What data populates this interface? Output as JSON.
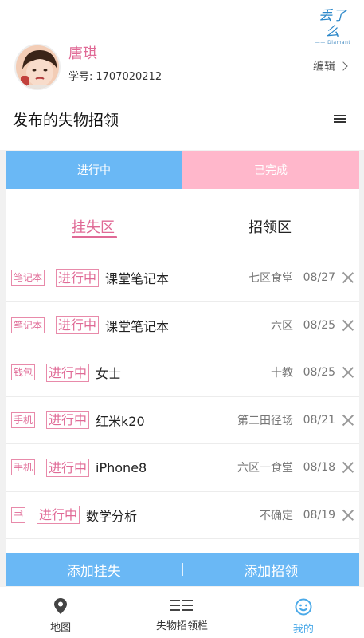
{
  "logo": {
    "main": "丢了么",
    "sub": "—— Diamant ——"
  },
  "profile": {
    "name": "唐琪",
    "student_id_label": "学号:",
    "student_id": "1707020212",
    "edit_label": "编辑"
  },
  "section_title": "发布的失物招领",
  "status_tabs": {
    "ongoing": "进行中",
    "done": "已完成"
  },
  "zone_tabs": {
    "lost": "挂失区",
    "found": "招领区"
  },
  "items": [
    {
      "category": "笔记本",
      "status": "进行中",
      "name": "课堂笔记本",
      "place": "七区食堂",
      "date": "08/27"
    },
    {
      "category": "笔记本",
      "status": "进行中",
      "name": "课堂笔记本",
      "place": "六区",
      "date": "08/25"
    },
    {
      "category": "钱包",
      "status": "进行中",
      "name": "女士",
      "place": "十教",
      "date": "08/25"
    },
    {
      "category": "手机",
      "status": "进行中",
      "name": "红米k20",
      "place": "第二田径场",
      "date": "08/21"
    },
    {
      "category": "手机",
      "status": "进行中",
      "name": "iPhone8",
      "place": "六区一食堂",
      "date": "08/18"
    },
    {
      "category": "书",
      "status": "进行中",
      "name": "数学分析",
      "place": "不确定",
      "date": "08/19"
    }
  ],
  "actions": {
    "add_lost": "添加挂失",
    "add_found": "添加招领"
  },
  "nav": {
    "map": "地图",
    "board": "失物招领栏",
    "mine": "我的"
  },
  "colors": {
    "accent_blue": "#6ab8f5",
    "accent_pink": "#e06a96",
    "done_pink": "#ffb7cb"
  }
}
